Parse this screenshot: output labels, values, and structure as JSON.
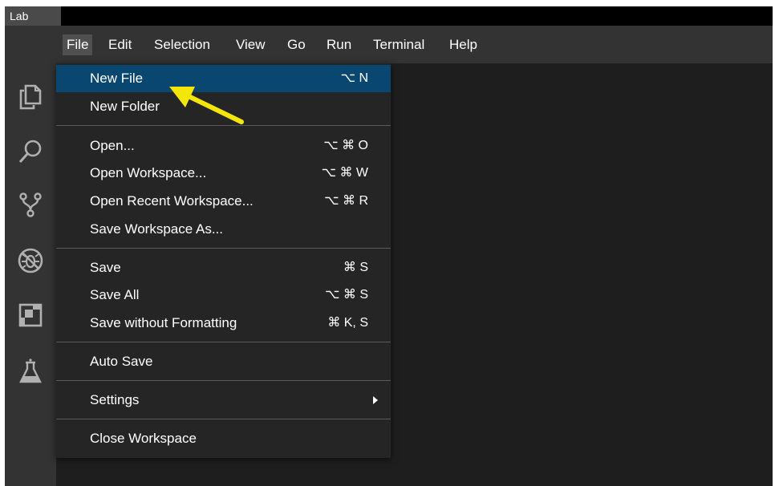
{
  "window": {
    "title": "Lab"
  },
  "menubar": {
    "items": [
      {
        "label": "File",
        "active": true
      },
      {
        "label": "Edit"
      },
      {
        "label": "Selection"
      },
      {
        "label": "View"
      },
      {
        "label": "Go"
      },
      {
        "label": "Run"
      },
      {
        "label": "Terminal"
      },
      {
        "label": "Help"
      }
    ]
  },
  "activitybar": {
    "icons": [
      "explorer-icon",
      "search-icon",
      "source-control-icon",
      "debug-icon",
      "extensions-icon",
      "lab-flask-icon"
    ]
  },
  "file_menu": {
    "items": [
      {
        "label": "New File",
        "shortcut": "⌥ N",
        "selected": true
      },
      {
        "label": "New Folder",
        "shortcut": ""
      },
      {
        "label": "Open...",
        "shortcut": "⌥ ⌘ O"
      },
      {
        "label": "Open Workspace...",
        "shortcut": "⌥ ⌘ W"
      },
      {
        "label": "Open Recent Workspace...",
        "shortcut": "⌥ ⌘ R"
      },
      {
        "label": "Save Workspace As...",
        "shortcut": ""
      },
      {
        "label": "Save",
        "shortcut": "⌘ S"
      },
      {
        "label": "Save All",
        "shortcut": "⌥ ⌘ S"
      },
      {
        "label": "Save without Formatting",
        "shortcut": "⌘ K, S"
      },
      {
        "label": "Auto Save",
        "shortcut": ""
      },
      {
        "label": "Settings",
        "shortcut": "",
        "submenu": true
      },
      {
        "label": "Close Workspace",
        "shortcut": ""
      }
    ]
  },
  "annotation": {
    "color": "#f5e60a"
  },
  "colors": {
    "selection": "#094771",
    "menu_bg": "#252526",
    "bar_bg": "#333333"
  }
}
